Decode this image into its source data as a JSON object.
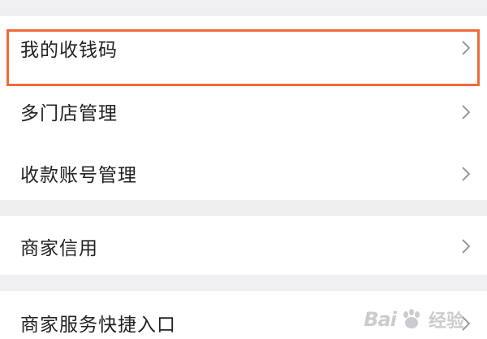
{
  "menu": {
    "groups": [
      {
        "items": [
          {
            "label": "我的收钱码",
            "icon": "chevron-right-icon",
            "highlighted": true
          },
          {
            "label": "多门店管理",
            "icon": "chevron-right-icon"
          },
          {
            "label": "收款账号管理",
            "icon": "chevron-right-icon"
          }
        ]
      },
      {
        "items": [
          {
            "label": "商家信用",
            "icon": "chevron-right-icon"
          }
        ]
      },
      {
        "items": [
          {
            "label": "商家服务快捷入口",
            "icon": "chevron-right-icon"
          }
        ]
      }
    ]
  },
  "highlight_color": "#ee6a3a",
  "watermark": {
    "brand": "Bai",
    "brand_suffix": "",
    "icon": "baidu-paw-icon",
    "jingyan": "经验"
  }
}
